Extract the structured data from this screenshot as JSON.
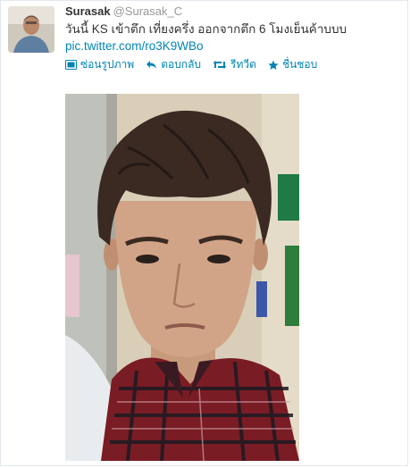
{
  "user": {
    "name": "Surasak",
    "handle": "@Surasak_C"
  },
  "tweet": {
    "text": "วันนี้ KS เข้าตึก เที่ยงครึ่ง ออกจากตึก 6 โมงเย็นค้าบบบ",
    "link": "pic.twitter.com/ro3K9WBo"
  },
  "actions": [
    {
      "label": "ซ่อนรูปภาพ",
      "icon": "image-icon"
    },
    {
      "label": "ตอบกลับ",
      "icon": "reply-icon"
    },
    {
      "label": "รีทวีต",
      "icon": "retweet-icon"
    },
    {
      "label": "ชื่นชอบ",
      "icon": "star-icon"
    }
  ],
  "colors": {
    "link": "#0084b4",
    "muted": "#999999",
    "text": "#333333"
  }
}
